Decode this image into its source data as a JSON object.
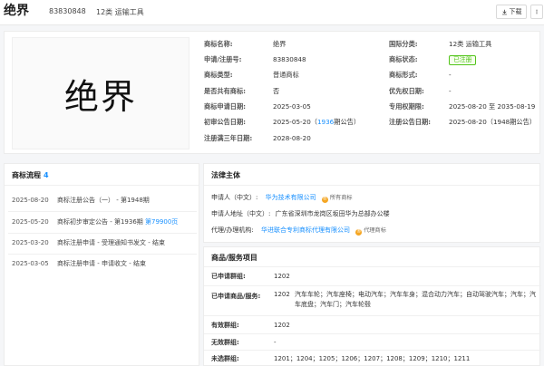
{
  "header": {
    "title": "绝界",
    "reg_no": "83830848",
    "class_text": "12类 运输工具",
    "download_label": "下载"
  },
  "logo_text": "绝界",
  "info": {
    "left": [
      {
        "k": "商标名称:",
        "v": "绝界"
      },
      {
        "k": "申请/注册号:",
        "v": "83830848"
      },
      {
        "k": "商标类型:",
        "v": "普通商标"
      },
      {
        "k": "是否共有商标:",
        "v": "否"
      },
      {
        "k": "商标申请日期:",
        "v": "2025-03-05"
      },
      {
        "k": "初审公告日期:",
        "v": "2025-05-20",
        "v_pre": "2025-05-20（",
        "v_link": "1936",
        "v_post": "期公告）"
      },
      {
        "k": "注册满三年日期:",
        "v": "2028-08-20"
      }
    ],
    "right": [
      {
        "k": "国际分类:",
        "v": "12类 运输工具"
      },
      {
        "k": "商标状态:",
        "badge": "已注册"
      },
      {
        "k": "商标形式:",
        "v": "-"
      },
      {
        "k": "优先权日期:",
        "v": "-"
      },
      {
        "k": "专用权期限:",
        "v": "2025-08-20 至 2035-08-19"
      },
      {
        "k": "注册公告日期:",
        "v": "2025-08-20（1948期公告）"
      }
    ]
  },
  "flow": {
    "title": "商标流程",
    "count": "4",
    "items": [
      {
        "date": "2025-08-20",
        "desc": "商标注册公告（一） - 第1948期",
        "link": ""
      },
      {
        "date": "2025-05-20",
        "desc": "商标初步审定公告 - 第1936期 ",
        "link": "第79900页"
      },
      {
        "date": "2025-03-20",
        "desc": "商标注册申请 - 受理通知书发文 - 结束",
        "link": ""
      },
      {
        "date": "2025-03-05",
        "desc": "商标注册申请 - 申请收文 - 结束",
        "link": ""
      }
    ]
  },
  "party": {
    "title": "法律主体",
    "applicant_label": "申请人（中文）:",
    "applicant": "华为技术有限公司",
    "applicant_tag": "所有商标",
    "address_label": "申请人地址（中文）:",
    "address": "广东省深圳市龙岗区坂田华为总部办公楼",
    "agent_label": "代理/办理机构:",
    "agent": "华进联合专利商标代理有限公司",
    "agent_tag": "代理商标"
  },
  "goods": {
    "title": "商品/服务项目",
    "rows": [
      {
        "k": "已申请群组:",
        "v": "1202"
      },
      {
        "k": "已申请商品/服务:",
        "code": "1202",
        "v": "汽车车轮；汽车座椅；电动汽车；汽车车身；混合动力汽车；自动驾驶汽车；汽车；汽车底盘；汽车门；汽车轮毂"
      },
      {
        "k": "有效群组:",
        "v": "1202"
      },
      {
        "k": "无效群组:",
        "v": "-"
      },
      {
        "k": "未选群组:",
        "v": "1201；1204；1205；1206；1207；1208；1209；1210；1211"
      }
    ]
  },
  "colors": {
    "accent": "#1890ff",
    "status_green": "#52c41a",
    "tag_orange": "#f5a623"
  }
}
